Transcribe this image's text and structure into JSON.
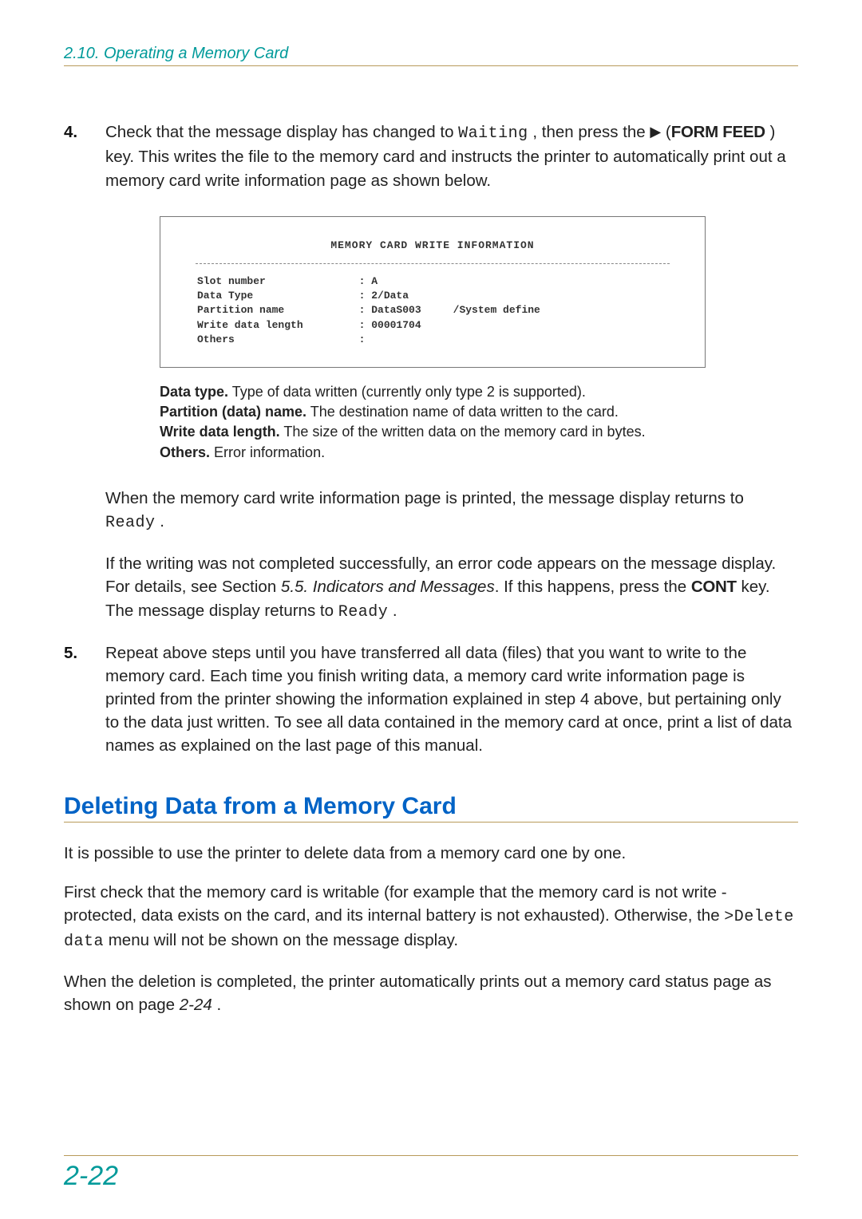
{
  "header": {
    "section": "2.10.  Operating a Memory Card"
  },
  "steps": {
    "four": {
      "num": "4.",
      "text_a": "Check that the message display has changed to ",
      "lcd_waiting": "Waiting",
      "text_b": " , then press the ",
      "tri": "▶",
      "text_c": " (",
      "key_formfeed": "FORM FEED",
      "text_d": " ) key. This writes the file to the memory card and instructs the printer to automatically print out a memory card write information page as shown below."
    },
    "five": {
      "num": "5.",
      "text": "Repeat above steps until you have transferred all data (files) that you want to write to the memory card. Each time you finish writing data, a memory card write information page is printed from the printer showing the information explained in step 4 above, but pertaining only to the data just written. To see all data contained in the memory card at once, print a list of data names as explained on the last page of this manual."
    }
  },
  "figure": {
    "title": "MEMORY CARD   WRITE   INFORMATION",
    "rows": [
      {
        "label": "Slot number",
        "value": ": A",
        "extra": ""
      },
      {
        "label": "Data Type",
        "value": ": 2/Data",
        "extra": ""
      },
      {
        "label": "Partition name",
        "value": ": DataS003",
        "extra": "/System define"
      },
      {
        "label": "Write data length",
        "value": ": 00001704",
        "extra": ""
      },
      {
        "label": "Others",
        "value": ":",
        "extra": ""
      }
    ]
  },
  "legend": {
    "l1a": "Data type.",
    "l1b": " Type of data written (currently only type 2 is supported).",
    "l2a": "Partition (data) name.",
    "l2b": " The destination name of data written to the card.",
    "l3a": "Write data length.",
    "l3b": " The size of the written data on the memory card in bytes.",
    "l4a": "Others.",
    "l4b": " Error information."
  },
  "paras": {
    "p1a": "When the memory card write information page is printed, the message display returns to ",
    "lcd_ready1": "Ready",
    "p1b": " .",
    "p2a": "If the writing was not completed successfully, an error code appears on the message display. For details, see Section ",
    "xref": "5.5.  Indicators and Messages",
    "p2b": ". If this happens, press the ",
    "key_cont": "CONT",
    "p2c": " key. The message display returns to ",
    "lcd_ready2": "Ready",
    "p2d": " ."
  },
  "section2": {
    "title": "Deleting Data from a Memory Card"
  },
  "section2_body": {
    "b1": "It is possible to use the printer to delete data from a memory card one by one.",
    "b2a": "First check that the memory card is writable (for example that the memory card is not write -protected, data exists on the card, and its internal battery is not exhausted). Otherwise, the ",
    "lcd_delete": ">Delete data",
    "b2b": " menu will not be shown on the message display.",
    "b3a": "When the deletion is completed, the printer automatically prints out a memory card status page as shown on page ",
    "pref": "2-24",
    "b3b": " ."
  },
  "footer": {
    "page": "2-22"
  }
}
